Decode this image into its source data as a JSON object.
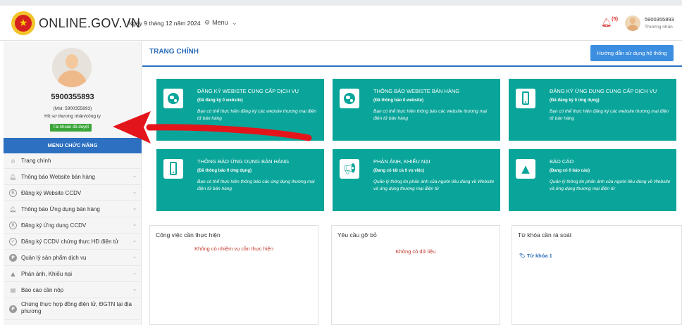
{
  "header": {
    "brand": "ONLINE.GOV.VN",
    "date": "Ngày 9 tháng 12 năm 2024",
    "menu_label": "Menu",
    "notification_count": "(5)",
    "user_name": "5900355893",
    "user_role": "Thương nhân"
  },
  "sidebar": {
    "profile_name": "5900355893",
    "profile_mst": "(Mst: 5900355893)",
    "profile_type": "Hồ sơ thương nhân/công ty",
    "profile_status": "Tài khoản đã duyệt",
    "menu_title": "MENU CHỨC NĂNG",
    "items": [
      {
        "label": "Trang chính",
        "icon": "home-icon"
      },
      {
        "label": "Thông báo Website bán hàng",
        "icon": "bell-icon"
      },
      {
        "label": "Đăng ký Website CCDV",
        "icon": "registered-icon"
      },
      {
        "label": "Thông báo Ứng dụng bán hàng",
        "icon": "bell-outline-icon"
      },
      {
        "label": "Đăng ký Ứng dụng CCDV",
        "icon": "registered-icon"
      },
      {
        "label": "Đăng ký CCDV chứng thực HĐ điện tử",
        "icon": "check-circle-icon"
      },
      {
        "label": "Quản lý sản phẩm dịch vụ",
        "icon": "product-icon"
      },
      {
        "label": "Phản ánh, Khiếu nại",
        "icon": "warning-icon"
      },
      {
        "label": "Báo cáo cần nộp",
        "icon": "document-icon"
      },
      {
        "label": "Chứng thực hợp đồng điện tử, ĐGTN tại địa phương",
        "icon": "contract-icon"
      }
    ]
  },
  "main": {
    "title": "TRANG CHÍNH",
    "guide_button": "Hướng dẫn sử dụng hệ thống",
    "cards": [
      {
        "title": "ĐĂNG KÝ WEBISTE CUNG CẤP DỊCH VỤ",
        "count": "(Đã đăng ký 0 website)",
        "desc": "Bạn có thể thực hiện đăng ký các website thương mại điện tử bán hàng",
        "icon": "globe-icon"
      },
      {
        "title": "THÔNG BÁO WEBISTE BÁN HÀNG",
        "count": "(Đã thông báo 0 website)",
        "desc": "Bạn có thể thực hiện thông báo các website thương mại điện tử bán hàng",
        "icon": "globe-icon"
      },
      {
        "title": "ĐĂNG KÝ ỨNG DỤNG CUNG CẤP DỊCH VỤ",
        "count": "(Đã đăng ký 0 ứng dụng)",
        "desc": "Bạn có thể thực hiện đăng ký các website thương mại điện tử bán hàng",
        "icon": "mobile-icon"
      },
      {
        "title": "THÔNG BÁO ỨNG DỤNG BÁN HÀNG",
        "count": "(Đã thông báo 0 ứng dụng)",
        "desc": "Bạn có thể thực hiện thông báo các ứng dụng thương mại điện tử bán hàng",
        "icon": "mobile-icon"
      },
      {
        "title": "PHẢN ÁNH, KHIẾU NẠI",
        "count": "(Đang có tất cả 0 vụ việc)",
        "desc": "Quản lý thông tin phản ánh của người tiêu dùng về Website và ứng dụng thương mại điện tử",
        "icon": "megaphone-icon"
      },
      {
        "title": "BÁO CÁO",
        "count": "(Đang có 0 báo cáo)",
        "desc": "Quản lý thông tin phản ánh của người tiêu dùng về Website và ứng dụng thương mại điện tử",
        "icon": "warning-icon"
      }
    ],
    "panels": {
      "tasks_title": "Công việc cần thực hiện",
      "tasks_empty": "Không có nhiệm vụ cần thực hiện",
      "requests_title": "Yêu cầu gỡ bỏ",
      "requests_empty": "Không có dữ liệu",
      "keywords_title": "Từ khóa cần rà soát",
      "keyword_1": "Từ khóa 1"
    }
  },
  "colors": {
    "card_teal": "#0aa59a",
    "primary_blue": "#2d70c1",
    "arrow_red": "#e4141b",
    "status_green": "#3aa63a"
  }
}
